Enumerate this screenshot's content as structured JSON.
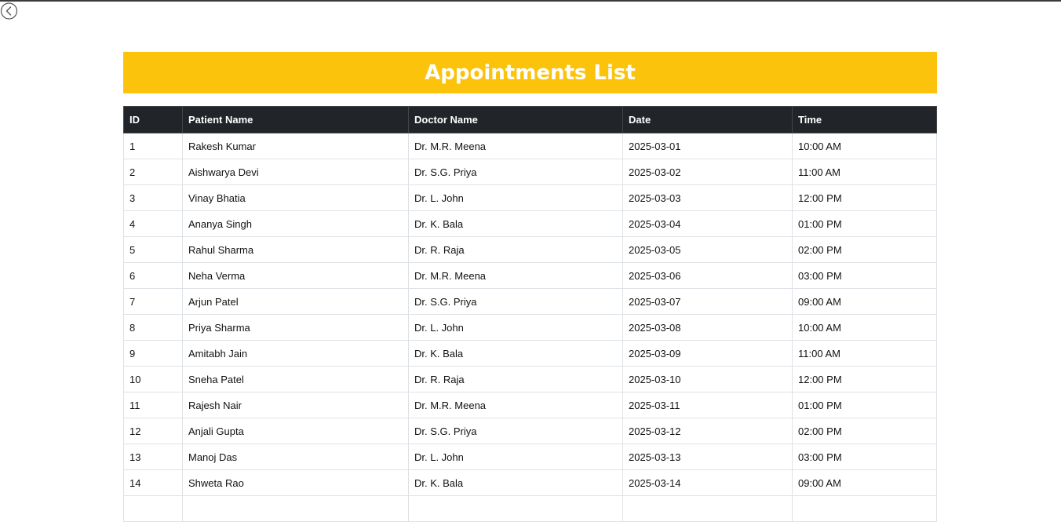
{
  "page": {
    "title": "Appointments List",
    "back_icon": "chevron-left-circle-icon",
    "accent_color": "#fcc30d",
    "header_color": "#212529"
  },
  "table": {
    "headers": [
      "ID",
      "Patient Name",
      "Doctor Name",
      "Date",
      "Time"
    ],
    "rows": [
      [
        "1",
        "Rakesh Kumar",
        "Dr. M.R. Meena",
        "2025-03-01",
        "10:00 AM"
      ],
      [
        "2",
        "Aishwarya Devi",
        "Dr. S.G. Priya",
        "2025-03-02",
        "11:00 AM"
      ],
      [
        "3",
        "Vinay Bhatia",
        "Dr. L. John",
        "2025-03-03",
        "12:00 PM"
      ],
      [
        "4",
        "Ananya Singh",
        "Dr. K. Bala",
        "2025-03-04",
        "01:00 PM"
      ],
      [
        "5",
        "Rahul Sharma",
        "Dr. R. Raja",
        "2025-03-05",
        "02:00 PM"
      ],
      [
        "6",
        "Neha Verma",
        "Dr. M.R. Meena",
        "2025-03-06",
        "03:00 PM"
      ],
      [
        "7",
        "Arjun Patel",
        "Dr. S.G. Priya",
        "2025-03-07",
        "09:00 AM"
      ],
      [
        "8",
        "Priya Sharma",
        "Dr. L. John",
        "2025-03-08",
        "10:00 AM"
      ],
      [
        "9",
        "Amitabh Jain",
        "Dr. K. Bala",
        "2025-03-09",
        "11:00 AM"
      ],
      [
        "10",
        "Sneha Patel",
        "Dr. R. Raja",
        "2025-03-10",
        "12:00 PM"
      ],
      [
        "11",
        "Rajesh Nair",
        "Dr. M.R. Meena",
        "2025-03-11",
        "01:00 PM"
      ],
      [
        "12",
        "Anjali Gupta",
        "Dr. S.G. Priya",
        "2025-03-12",
        "02:00 PM"
      ],
      [
        "13",
        "Manoj Das",
        "Dr. L. John",
        "2025-03-13",
        "03:00 PM"
      ],
      [
        "14",
        "Shweta Rao",
        "Dr. K. Bala",
        "2025-03-14",
        "09:00 AM"
      ],
      [
        "",
        "",
        "",
        "",
        ""
      ]
    ]
  }
}
